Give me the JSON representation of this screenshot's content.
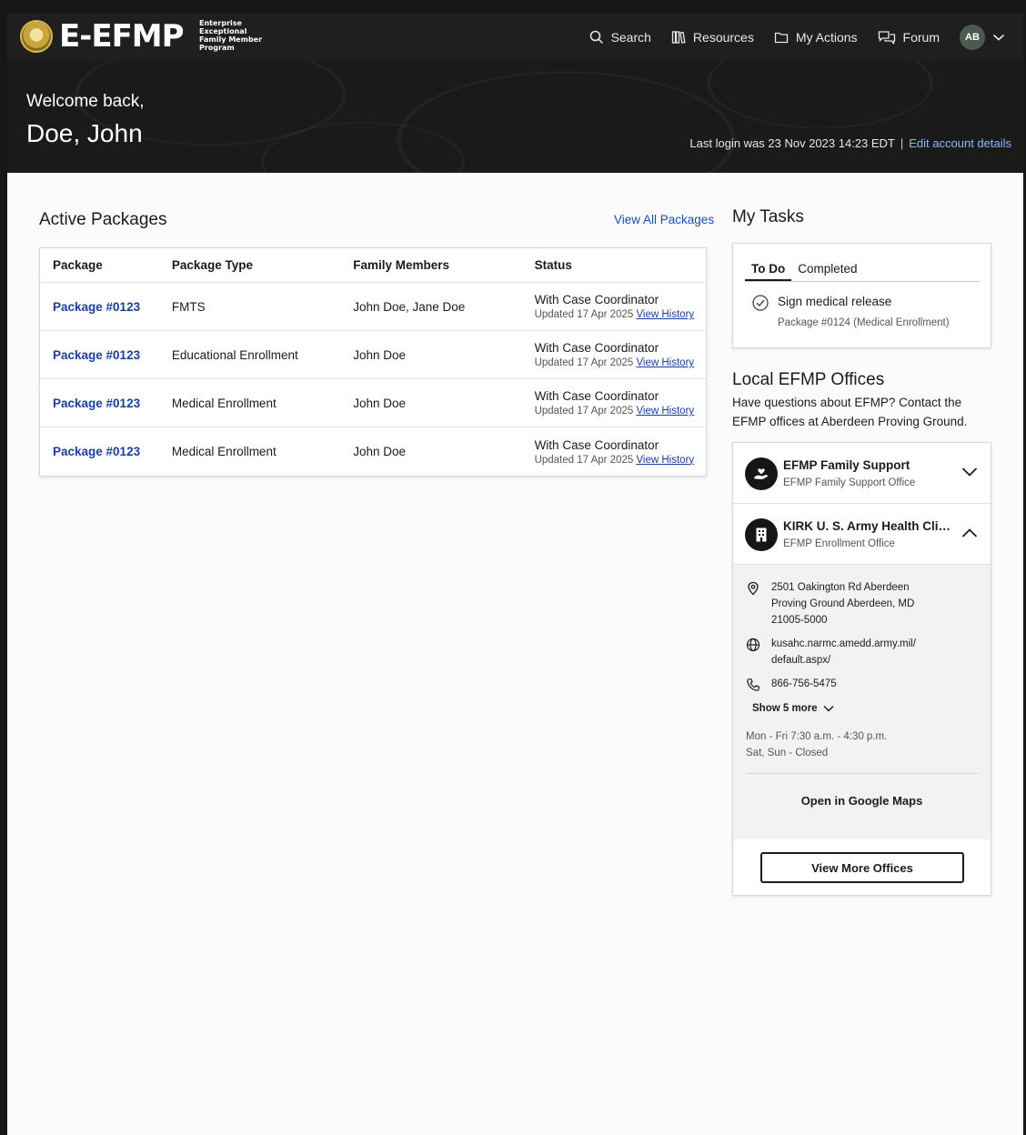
{
  "header": {
    "logo_text": "E-EFMP",
    "logo_subtitle": "Enterprise Exceptional Family Member Program",
    "nav": {
      "search": "Search",
      "resources": "Resources",
      "my_actions": "My Actions",
      "forum": "Forum"
    },
    "avatar_initials": "AB"
  },
  "hero": {
    "welcome": "Welcome back,",
    "user_name": "Doe, John",
    "last_login": "Last login was 23 Nov 2023 14:23 EDT",
    "separator": "|",
    "edit_account": "Edit account details"
  },
  "packages": {
    "title": "Active Packages",
    "view_all": "View All Packages",
    "columns": [
      "Package",
      "Package Type",
      "Family Members",
      "Status"
    ],
    "rows": [
      {
        "package": "Package #0123",
        "type": "FMTS",
        "members": "John Doe, Jane Doe",
        "status": "With Case Coordinator",
        "updated": "Updated 17 Apr 2025",
        "history": "View History"
      },
      {
        "package": "Package #0123",
        "type": "Educational Enrollment",
        "members": "John Doe",
        "status": "With Case Coordinator",
        "updated": "Updated 17 Apr 2025",
        "history": "View History"
      },
      {
        "package": "Package #0123",
        "type": "Medical Enrollment",
        "members": "John Doe",
        "status": "With Case Coordinator",
        "updated": "Updated 17 Apr 2025",
        "history": "View History"
      },
      {
        "package": "Package #0123",
        "type": "Medical Enrollment",
        "members": "John Doe",
        "status": "With Case Coordinator",
        "updated": "Updated 17 Apr 2025",
        "history": "View History"
      }
    ]
  },
  "tasks": {
    "title": "My Tasks",
    "tabs": [
      "To Do",
      "Completed"
    ],
    "active_tab": "To Do",
    "items": [
      {
        "title": "Sign medical release",
        "subtitle": "Package #0124 (Medical Enrollment)"
      }
    ]
  },
  "offices": {
    "title": "Local EFMP Offices",
    "description": "Have questions about EFMP? Contact the EFMP offices at Aberdeen Proving Ground.",
    "items": [
      {
        "name": "EFMP Family Support",
        "subtitle": "EFMP Family Support Office",
        "expanded": false
      },
      {
        "name": "KIRK U. S. Army Health Clinic (KUSAHC)",
        "subtitle": "EFMP Enrollment Office",
        "expanded": true
      }
    ],
    "details": {
      "address": "2501 Oakington Rd Aberdeen Proving Ground Aberdeen, MD 21005-5000",
      "website": "kusahc.narmc.amedd.army.mil/ default.aspx/",
      "phone": "866-756-5475",
      "show_more": "Show 5 more",
      "hours_weekday": "Mon - Fri 7:30 a.m. - 4:30 p.m.",
      "hours_weekend": "Sat, Sun - Closed",
      "maps_link": "Open in Google Maps"
    },
    "view_more": "View More Offices"
  }
}
